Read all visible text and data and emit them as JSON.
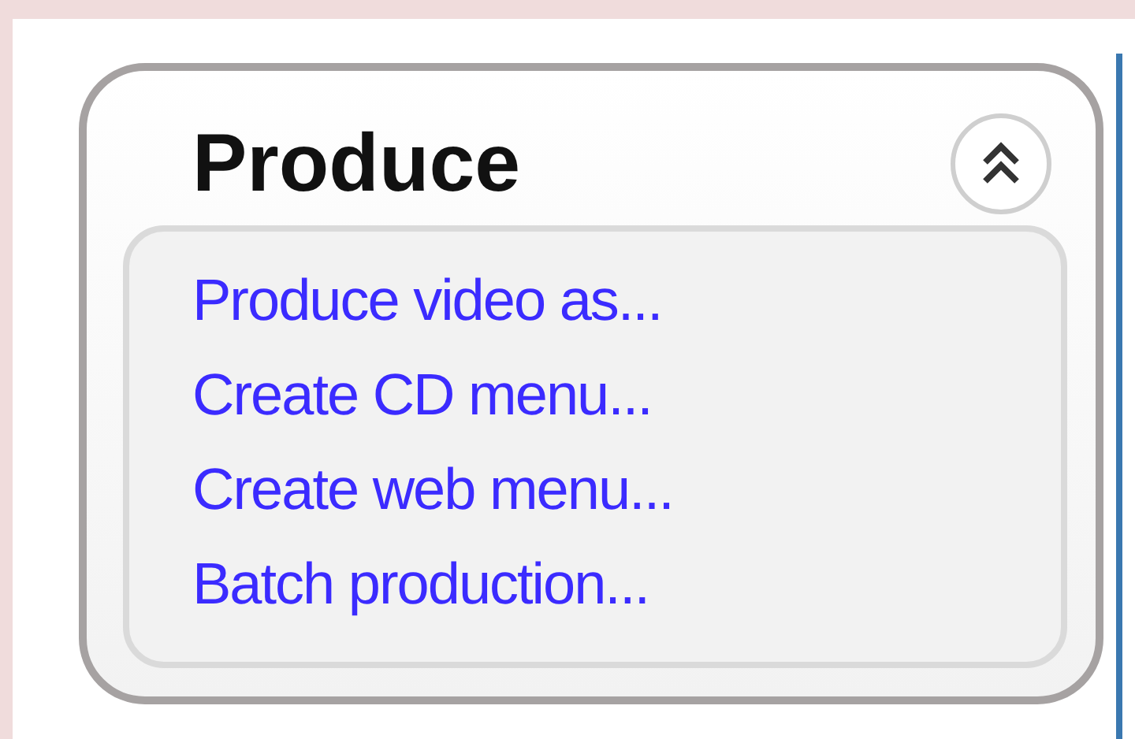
{
  "panel": {
    "title": "Produce",
    "expanded": true,
    "links": [
      "Produce video as...",
      "Create CD menu...",
      "Create web menu...",
      "Batch production..."
    ]
  }
}
